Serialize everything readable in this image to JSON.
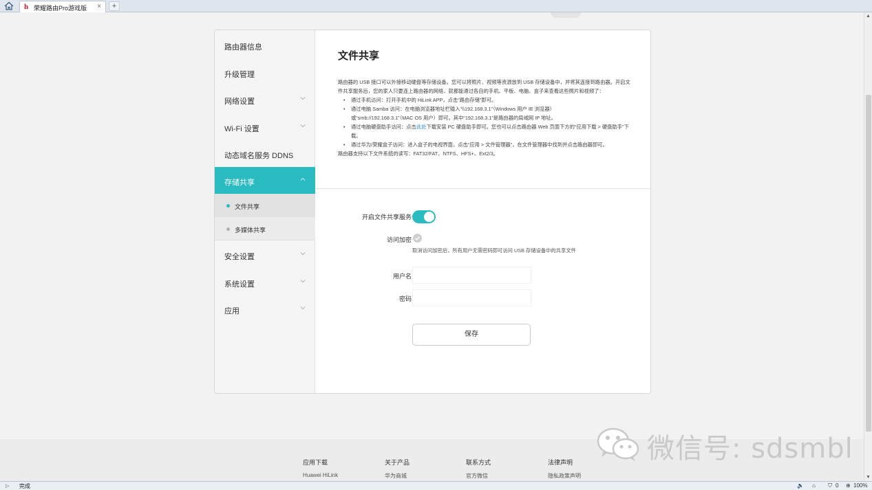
{
  "browser": {
    "tab_title": "荣耀路由Pro游戏版",
    "tab_close": "×",
    "new_tab": "+",
    "status_text": "完成",
    "protected_count": "0",
    "zoom": "100%"
  },
  "sidebar": {
    "items": [
      {
        "label": "路由器信息"
      },
      {
        "label": "升级管理"
      },
      {
        "label": "网络设置"
      },
      {
        "label": "Wi-Fi 设置"
      },
      {
        "label": "动态域名服务 DDNS"
      },
      {
        "label": "存储共享"
      },
      {
        "label": "安全设置"
      },
      {
        "label": "系统设置"
      },
      {
        "label": "应用"
      }
    ],
    "sub_items": [
      {
        "label": "文件共享"
      },
      {
        "label": "多媒体共享"
      }
    ]
  },
  "content": {
    "title": "文件共享",
    "intro": "路由器的 USB 接口可以外接移动硬盘等存储设备。您可以将照片、视频等资源放到 USB 存储设备中，并将其连接到路由器。开启文件共享服务后，您的家人只要连上路由器的网络，就都能通过各自的手机、平板、电脑、盒子来查看这些照片和视频了：",
    "bullets": [
      {
        "line1": "通过手机访问：打开手机中的 HiLink APP，点击“路由存储”即可。"
      },
      {
        "line1": "通过电脑 Samba 访问：在电脑浏览器地址栏输入“\\\\192.168.3.1”（Windows 用户 IE 浏览器）",
        "line2": "或“smb://192.168.3.1”（MAC OS 用户）即可。其中“192.168.3.1”是路由器的局域网 IP 地址。"
      },
      {
        "before": "通过电脑硬盘助手访问：点击",
        "link": "此处",
        "after": "下载安装 PC 硬盘助手即可。您也可以点击路由器 Web 页面下方的“应用下载 > 硬盘助手”下载。"
      },
      {
        "line1": "通过华为/荣耀盒子访问：进入盒子的电视界面，点击“应用 > 文件管理器”，在文件管理器中找到并点击路由器即可。"
      }
    ],
    "fs_support": "路由器支持以下文件系统的读写：FAT32/FAT、NTFS、HFS+、Ext2/3。",
    "form": {
      "enable_label": "开启文件共享服务",
      "enable_on": true,
      "encrypt_label": "访问加密",
      "encrypt_hint": "取消访问加密后，所有用户无需密码即可访问 USB 存储设备中的共享文件",
      "username_label": "用户名",
      "username_value": "",
      "password_label": "密码",
      "password_value": "",
      "save_label": "保存"
    }
  },
  "footer": {
    "columns": [
      {
        "heading": "应用下载",
        "link": "Huawei HiLink"
      },
      {
        "heading": "关于产品",
        "link": "华为商城"
      },
      {
        "heading": "联系方式",
        "link": "官方微信"
      },
      {
        "heading": "法律声明",
        "link": "隐私政策声明"
      }
    ],
    "watermark": "微信号: sdsmbl"
  },
  "colors": {
    "accent": "#2abbc1",
    "link": "#2a8fd8"
  }
}
